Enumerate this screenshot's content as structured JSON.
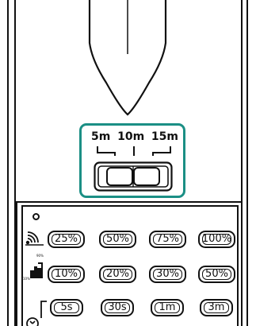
{
  "range": {
    "label_5m": "5m",
    "label_10m": "10m",
    "label_15m": "15m",
    "accent_color": "#1b8f85"
  },
  "rows": {
    "power": {
      "icon": "signal-strength-icon",
      "buttons": [
        "25%",
        "50%",
        "75%",
        "100%"
      ]
    },
    "brightness": {
      "icon": "brightness-level-icon",
      "icon_label_top": "90%",
      "icon_label_bottom": "10%",
      "buttons": [
        "10%",
        "20%",
        "30%",
        "50%"
      ]
    },
    "timer": {
      "icon": "timer-icon",
      "buttons": [
        "5s",
        "30s",
        "1m",
        "3m"
      ]
    }
  }
}
